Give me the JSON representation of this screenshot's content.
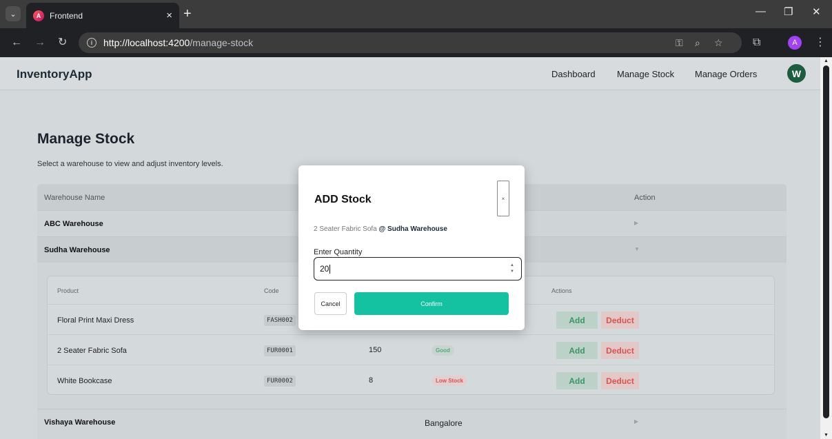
{
  "browser": {
    "tab_title": "Frontend",
    "url_host": "http://localhost:4200",
    "url_path": "/manage-stock",
    "profile_initial": "A",
    "icons": [
      "tab-search-icon",
      "favicon-icon",
      "close-icon",
      "plus-icon",
      "minimize-icon",
      "restore-icon",
      "window-close-icon",
      "back-icon",
      "forward-icon",
      "reload-icon",
      "info-icon",
      "password-key-icon",
      "zoom-icon",
      "star-icon",
      "extensions-icon",
      "more-menu-icon"
    ]
  },
  "header": {
    "brand": "InventoryApp",
    "nav": [
      "Dashboard",
      "Manage Stock",
      "Manage Orders"
    ],
    "avatar_initial": "W"
  },
  "page": {
    "title": "Manage Stock",
    "subtitle": "Select a warehouse to view and adjust inventory levels."
  },
  "warehouse_table": {
    "columns": [
      "Warehouse Name",
      "Action"
    ],
    "rows": [
      {
        "name": "ABC Warehouse",
        "city": "",
        "expanded": false
      },
      {
        "name": "Sudha Warehouse",
        "city": "",
        "expanded": true
      },
      {
        "name": "Vishaya Warehouse",
        "city": "Bangalore",
        "expanded": false
      }
    ]
  },
  "product_table": {
    "columns": [
      "Product",
      "Code",
      "Actions"
    ],
    "add_label": "Add",
    "deduct_label": "Deduct",
    "rows": [
      {
        "product": "Floral Print Maxi Dress",
        "code": "FASH002",
        "qty": "",
        "status": ""
      },
      {
        "product": "2 Seater Fabric Sofa",
        "code": "FUR0001",
        "qty": "150",
        "status": "Good"
      },
      {
        "product": "White Bookcase",
        "code": "FUR0002",
        "qty": "8",
        "status": "Low Stock"
      }
    ]
  },
  "modal": {
    "title": "ADD Stock",
    "close_label": "×",
    "product": "2 Seater Fabric Sofa",
    "at": "@",
    "warehouse": "Sudha Warehouse",
    "qty_label": "Enter Quantity",
    "qty_value": "20",
    "cancel_label": "Cancel",
    "confirm_label": "Confirm"
  },
  "colors": {
    "confirm": "#14c1a1",
    "add": "#3a9467",
    "deduct": "#d9534f",
    "avatar": "#1b5e3f"
  }
}
